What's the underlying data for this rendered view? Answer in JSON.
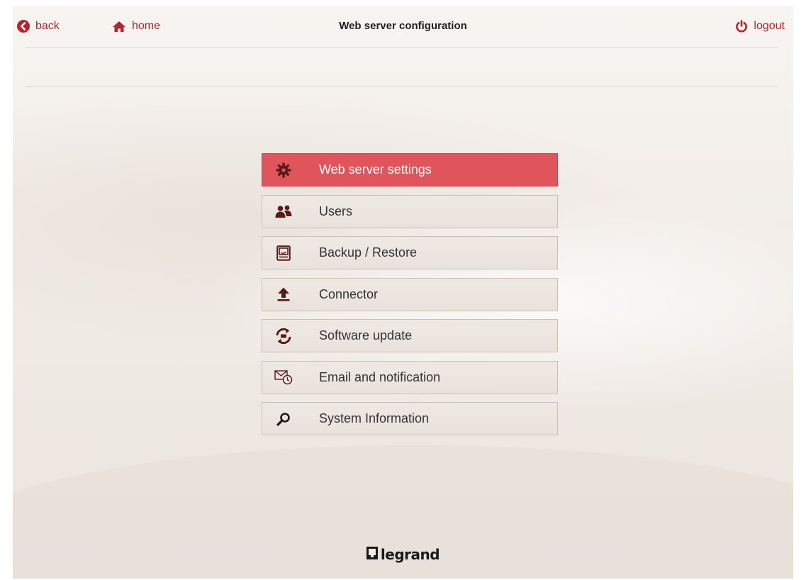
{
  "header": {
    "back_label": "back",
    "home_label": "home",
    "title": "Web server configuration",
    "logout_label": "logout"
  },
  "menu": {
    "items": [
      {
        "label": "Web server settings",
        "icon": "gear-icon",
        "active": true
      },
      {
        "label": "Users",
        "icon": "users-icon",
        "active": false
      },
      {
        "label": "Backup / Restore",
        "icon": "backup-icon",
        "active": false
      },
      {
        "label": "Connector",
        "icon": "upload-icon",
        "active": false
      },
      {
        "label": "Software update",
        "icon": "refresh-icon",
        "active": false
      },
      {
        "label": "Email and notification",
        "icon": "email-clock-icon",
        "active": false
      },
      {
        "label": "System Information",
        "icon": "magnifier-icon",
        "active": false
      }
    ]
  },
  "footer": {
    "logo_text": "legrand"
  },
  "colors": {
    "accent": "#b4232f",
    "active_item": "#e0545c",
    "icon": "#5a1a1a"
  }
}
